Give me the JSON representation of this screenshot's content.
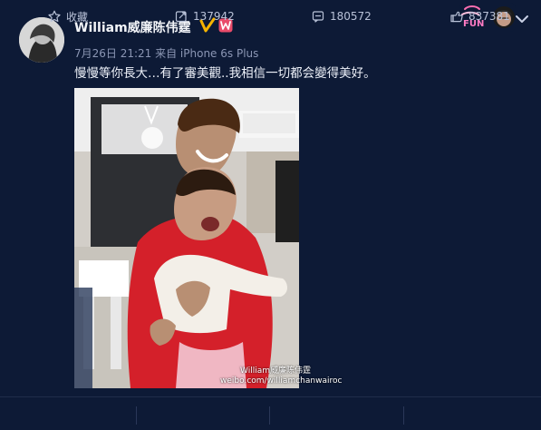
{
  "post": {
    "username": "William威廉陈伟霆",
    "meta": "7月26日 21:21 来自 iPhone 6s Plus",
    "text": "慢慢等你長大…有了審美觀..我相信一切都会變得美好。",
    "photo_watermark": {
      "line1": "William威廉陈伟霆",
      "line2": "weibo.com/williamchanwairoc"
    }
  },
  "actions": {
    "favorite": "收藏",
    "repost": "137942",
    "comment": "180572",
    "like": "837381"
  },
  "colors": {
    "background": "#0d1a36",
    "verified": "#f6b400",
    "vip": "#e94b6a"
  }
}
